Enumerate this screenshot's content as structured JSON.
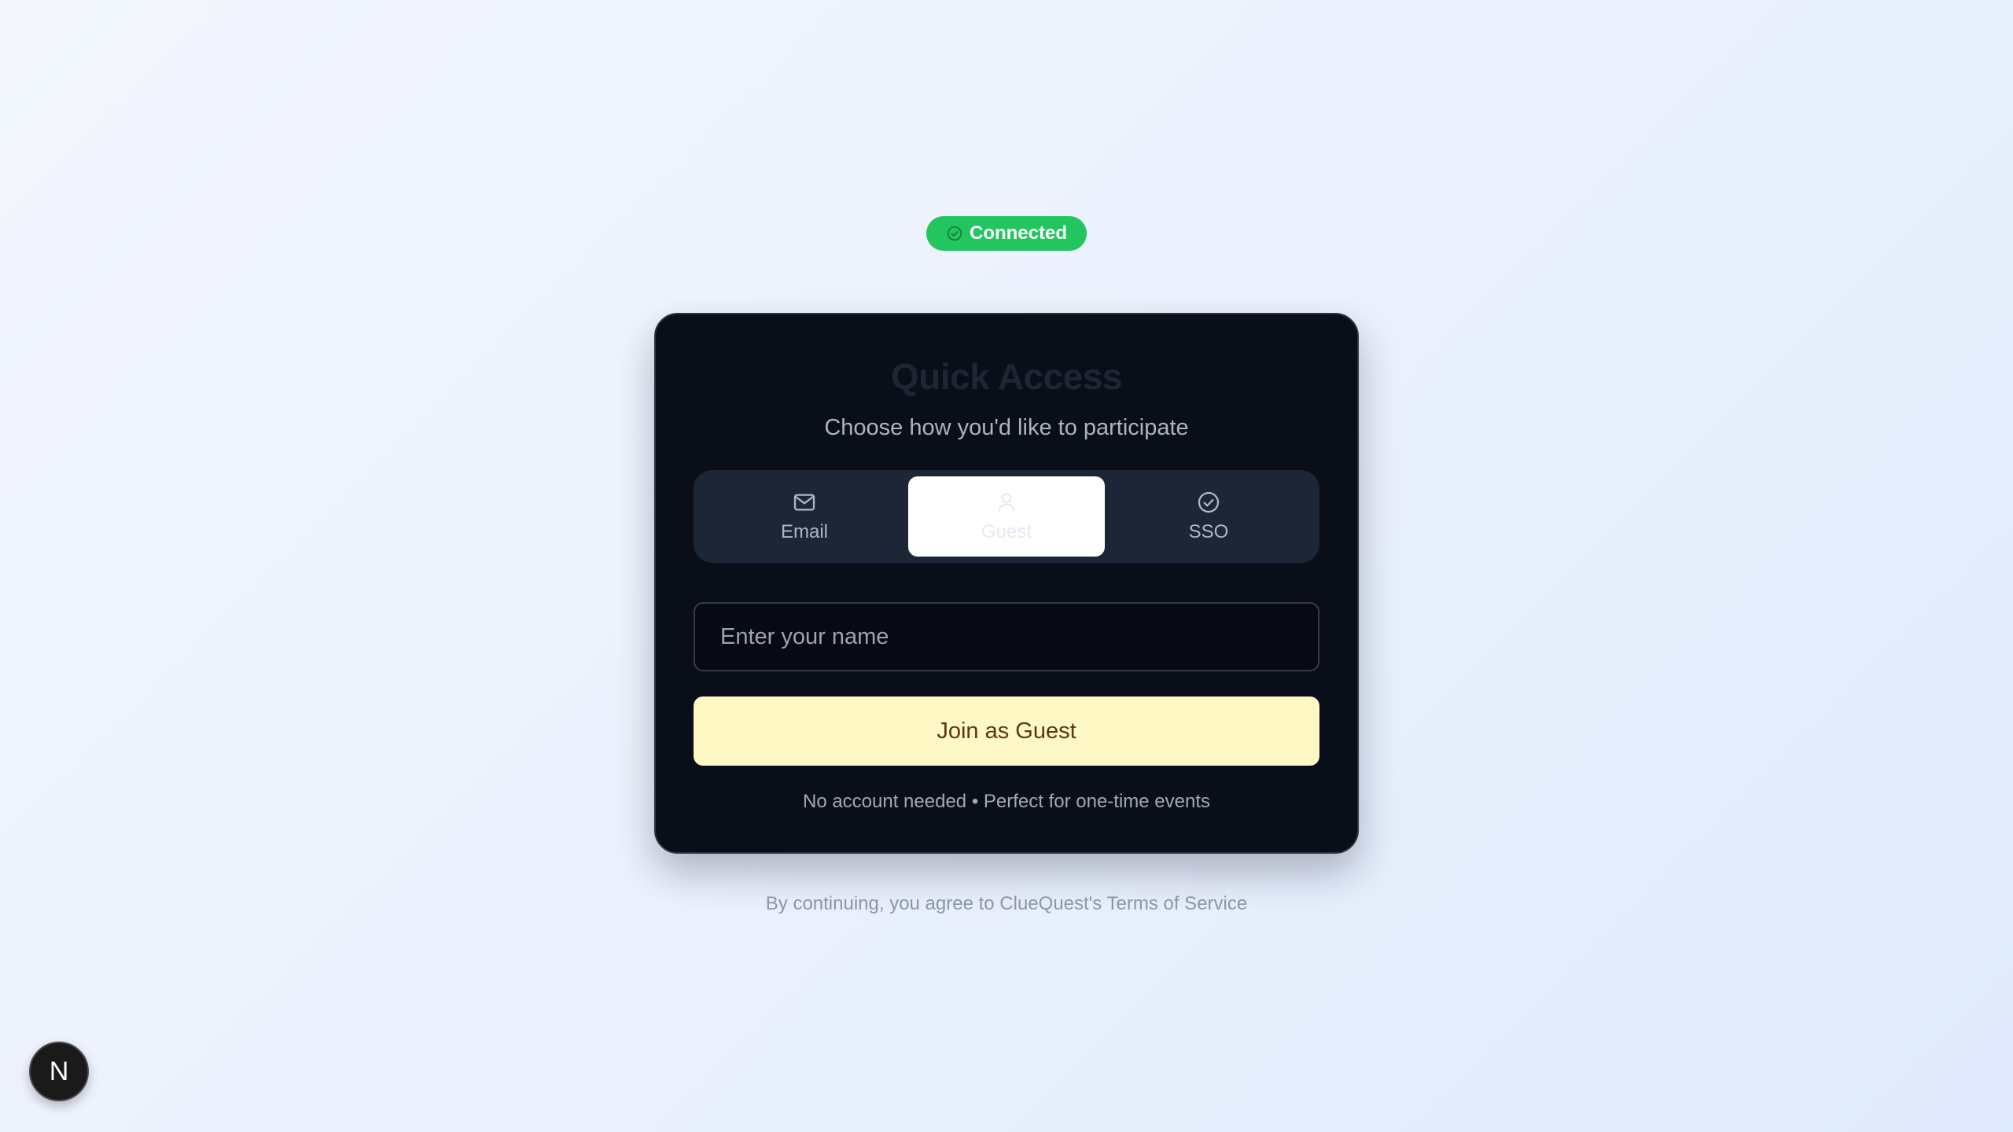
{
  "status": {
    "label": "Connected",
    "icon": "check-circle-icon",
    "color": "#22c55e"
  },
  "card": {
    "title": "Quick Access",
    "subtitle": "Choose how you'd like to participate",
    "tabs": [
      {
        "label": "Email",
        "icon": "mail-icon",
        "selected": false
      },
      {
        "label": "Guest",
        "icon": "user-icon",
        "selected": true
      },
      {
        "label": "SSO",
        "icon": "check-circle-icon",
        "selected": false
      }
    ],
    "name_input": {
      "placeholder": "Enter your name",
      "value": ""
    },
    "join_button_label": "Join as Guest",
    "hint": "No account needed • Perfect for one-time events"
  },
  "terms": "By continuing, you agree to ClueQuest's Terms of Service",
  "dev_badge": {
    "label": "N"
  },
  "colors": {
    "card_background": "#0a0e19",
    "accent_button": "#fef8c4",
    "page_background": "#ebf1fd"
  }
}
